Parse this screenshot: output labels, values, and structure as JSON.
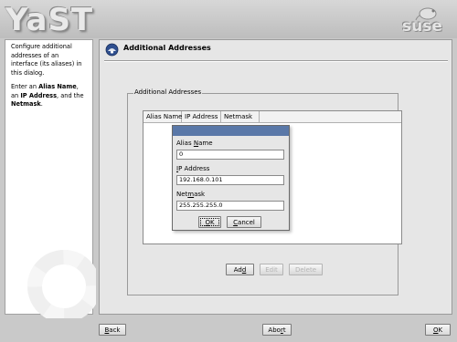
{
  "header": {
    "app_logo_text": "YaST",
    "vendor_logo_text": "suse"
  },
  "help": {
    "p1": "Configure additional addresses of an interface (its aliases) in this dialog.",
    "p2_pre": "Enter an ",
    "p2_b1": "Alias Name",
    "p2_mid1": ", an ",
    "p2_b2": "IP Address",
    "p2_mid2": ", and the ",
    "p2_b3": "Netmask",
    "p2_end": "."
  },
  "main": {
    "title": "Additional Addresses",
    "group_label": "Additional Addresses",
    "table": {
      "columns": [
        "Alias Name",
        "IP Address",
        "Netmask"
      ]
    },
    "buttons": {
      "add": {
        "pre": "Ad",
        "u": "d",
        "post": ""
      },
      "edit": "Edit",
      "delete": "Delete"
    }
  },
  "dialog": {
    "alias": {
      "pre": "Alias ",
      "u": "N",
      "post": "ame",
      "value": "0"
    },
    "ip": {
      "pre": "",
      "u": "I",
      "post": "P Address",
      "value": "192.168.0.101"
    },
    "netmask": {
      "pre": "Net",
      "u": "m",
      "post": "ask",
      "value": "255.255.255.0"
    },
    "ok": {
      "pre": "",
      "u": "O",
      "post": "K"
    },
    "cancel": {
      "pre": "",
      "u": "C",
      "post": "ancel"
    }
  },
  "footer": {
    "back": {
      "pre": "",
      "u": "B",
      "post": "ack"
    },
    "abort": {
      "pre": "Abo",
      "u": "r",
      "post": "t"
    },
    "ok": {
      "pre": "",
      "u": "O",
      "post": "K"
    }
  },
  "colors": {
    "dialog_titlebar": "#5a78a8",
    "logo_green": "#3c7a1e"
  }
}
